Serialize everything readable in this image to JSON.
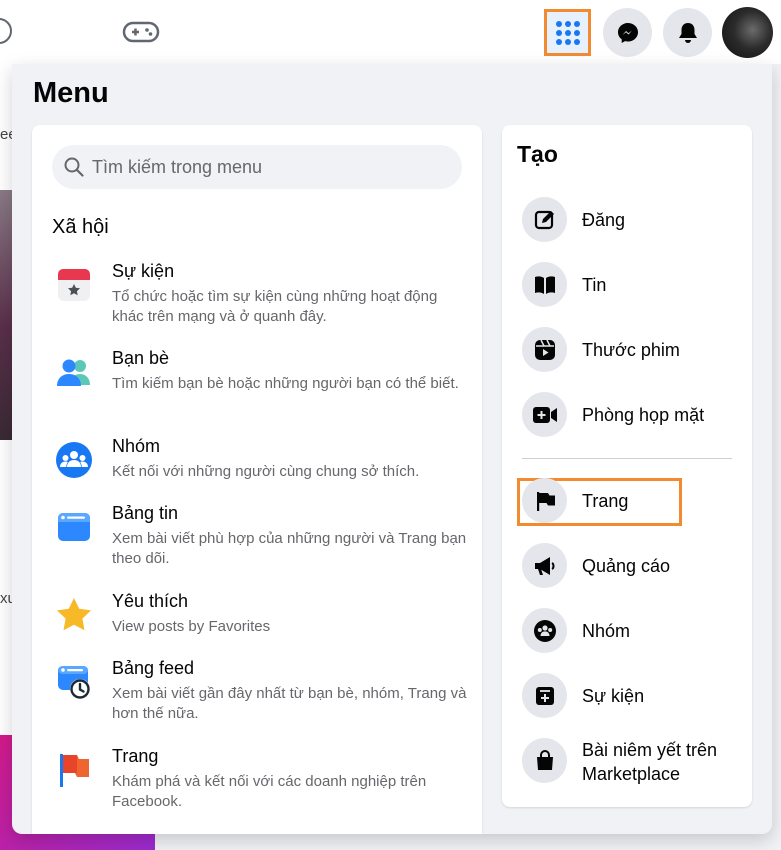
{
  "menu": {
    "title": "Menu"
  },
  "search": {
    "placeholder": "Tìm kiếm trong menu"
  },
  "social": {
    "title": "Xã hội",
    "items": [
      {
        "icon": "calendar-icon",
        "title": "Sự kiện",
        "desc": "Tổ chức hoặc tìm sự kiện cùng những hoạt động khác trên mạng và ở quanh đây."
      },
      {
        "icon": "friends-icon",
        "title": "Bạn bè",
        "desc": "Tìm kiếm bạn bè hoặc những người bạn có thể biết."
      },
      {
        "icon": "groups-icon",
        "title": "Nhóm",
        "desc": "Kết nối với những người cùng chung sở thích."
      },
      {
        "icon": "feed-icon",
        "title": "Bảng tin",
        "desc": "Xem bài viết phù hợp của những người và Trang bạn theo dõi."
      },
      {
        "icon": "star-icon",
        "title": "Yêu thích",
        "desc": "View posts by Favorites"
      },
      {
        "icon": "recent-feed-icon",
        "title": "Bảng feed",
        "desc": "Xem bài viết gần đây nhất từ bạn bè, nhóm, Trang và hơn thế nữa."
      },
      {
        "icon": "pages-flag-icon",
        "title": "Trang",
        "desc": "Khám phá và kết nối với các doanh nghiệp trên Facebook."
      }
    ]
  },
  "create": {
    "title": "Tạo",
    "items": [
      {
        "icon": "edit-icon",
        "label": "Đăng"
      },
      {
        "icon": "book-icon",
        "label": "Tin"
      },
      {
        "icon": "reel-icon",
        "label": "Thước phim"
      },
      {
        "icon": "video-call-icon",
        "label": "Phòng họp mặt"
      },
      {
        "icon": "flag-icon",
        "label": "Trang"
      },
      {
        "icon": "megaphone-icon",
        "label": "Quảng cáo"
      },
      {
        "icon": "group-icon",
        "label": "Nhóm"
      },
      {
        "icon": "event-icon",
        "label": "Sự kiện"
      },
      {
        "icon": "shopping-bag-icon",
        "label": "Bài niêm yết trên Marketplace"
      }
    ]
  },
  "background": {
    "text1": "ee",
    "text2": "xu"
  },
  "colors": {
    "accent": "#1877f2",
    "highlight": "#f28b30",
    "text": "#050505",
    "secondary": "#65676b"
  }
}
